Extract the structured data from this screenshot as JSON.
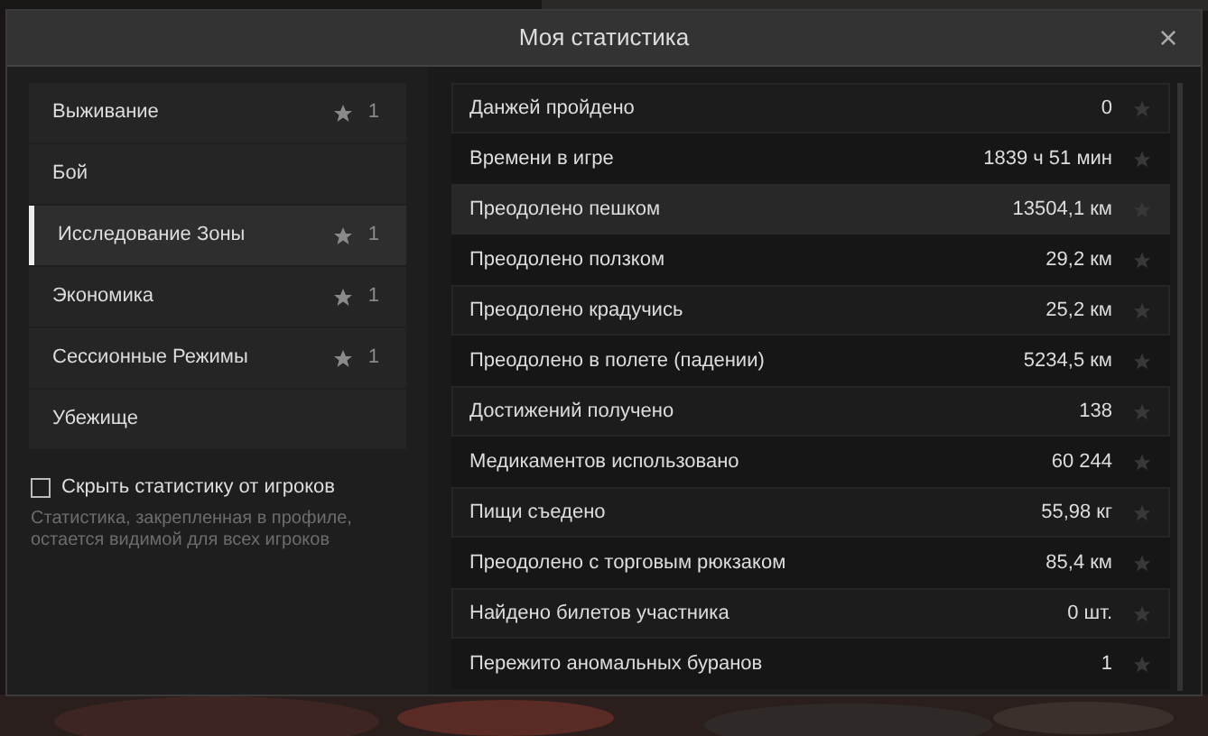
{
  "window": {
    "title": "Моя статистика",
    "close": "×"
  },
  "categories": [
    {
      "label": "Выживание",
      "count": "1",
      "selected": false
    },
    {
      "label": "Бой",
      "selected": false
    },
    {
      "label": "Исследование Зоны",
      "count": "1",
      "selected": true
    },
    {
      "label": "Экономика",
      "count": "1",
      "selected": false
    },
    {
      "label": "Сессионные Режимы",
      "count": "1",
      "selected": false
    },
    {
      "label": "Убежище",
      "selected": false
    }
  ],
  "hide_stats": {
    "label": "Скрыть статистику от игроков",
    "checked": false
  },
  "note": "Статистика, закрепленная в профиле, остается видимой для всех игроков",
  "stats": [
    {
      "label": "Данжей пройдено",
      "value": "0",
      "selected": false,
      "pinned": false
    },
    {
      "label": "Времени в игре",
      "value": "1839 ч 51 мин",
      "selected": false,
      "pinned": false
    },
    {
      "label": "Преодолено пешком",
      "value": "13504,1 км",
      "selected": true,
      "pinned": false
    },
    {
      "label": "Преодолено ползком",
      "value": "29,2 км",
      "selected": false,
      "pinned": false
    },
    {
      "label": "Преодолено крадучись",
      "value": "25,2 км",
      "selected": false,
      "pinned": false
    },
    {
      "label": "Преодолено в полете (падении)",
      "value": "5234,5 км",
      "selected": false,
      "pinned": false
    },
    {
      "label": "Достижений получено",
      "value": "138",
      "selected": false,
      "pinned": false
    },
    {
      "label": "Медикаментов использовано",
      "value": "60 244",
      "selected": false,
      "pinned": false
    },
    {
      "label": "Пищи съедено",
      "value": "55,98 кг",
      "selected": false,
      "pinned": false
    },
    {
      "label": "Преодолено с торговым рюкзаком",
      "value": "85,4 км",
      "selected": false,
      "pinned": false
    },
    {
      "label": "Найдено билетов участника",
      "value": "0 шт.",
      "selected": false,
      "pinned": false
    },
    {
      "label": "Пережито аномальных буранов",
      "value": "1",
      "selected": false,
      "pinned": false
    }
  ]
}
